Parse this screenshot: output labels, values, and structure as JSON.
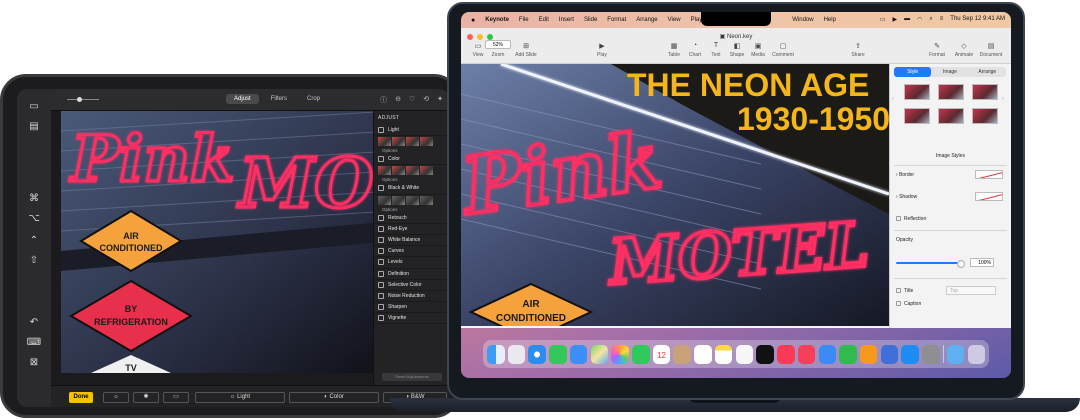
{
  "ipad": {
    "sidecar_icons": [
      "sidebar-icon",
      "menu-icon",
      "command-key-icon",
      "option-key-icon",
      "control-key-icon",
      "shift-key-icon",
      "undo-icon",
      "keyboard-icon",
      "disconnect-icon"
    ],
    "photos": {
      "tabs": [
        {
          "label": "Adjust",
          "active": true
        },
        {
          "label": "Filters",
          "active": false
        },
        {
          "label": "Crop",
          "active": false
        }
      ],
      "panel_title": "ADJUST",
      "adjustments": [
        {
          "label": "Light",
          "expanded": true,
          "options": "Options"
        },
        {
          "label": "Color",
          "expanded": true,
          "options": "Options"
        },
        {
          "label": "Black & White",
          "expanded": true,
          "options": "Options"
        },
        {
          "label": "Retouch"
        },
        {
          "label": "Red-Eye"
        },
        {
          "label": "White Balance"
        },
        {
          "label": "Curves"
        },
        {
          "label": "Levels"
        },
        {
          "label": "Definition"
        },
        {
          "label": "Selective Color"
        },
        {
          "label": "Noise Reduction"
        },
        {
          "label": "Sharpen"
        },
        {
          "label": "Vignette"
        }
      ],
      "reset_label": "Reset Adjustments",
      "done_label": "Done",
      "modes": [
        "Light",
        "Color",
        "B&W"
      ],
      "image_signs": {
        "air": "AIR",
        "conditioned": "CONDITIONED",
        "by": "BY",
        "refrigeration": "REFRIGERATION",
        "pink": "Pink",
        "motel": "MO",
        "tv": "TV"
      }
    }
  },
  "mac": {
    "menubar": {
      "app": "Keynote",
      "items": [
        "File",
        "Edit",
        "Insert",
        "Slide",
        "Format",
        "Arrange",
        "View",
        "Play",
        "Window",
        "Help"
      ],
      "datetime": "Thu Sep 12  9:41 AM"
    },
    "keynote": {
      "document_title": "Neon.key",
      "zoom": "52%",
      "toolbar": [
        {
          "label": "View",
          "icon": "sidebar-icon"
        },
        {
          "label": "Zoom",
          "icon": "zoom-icon"
        },
        {
          "label": "Add Slide",
          "icon": "add-slide-icon"
        },
        {
          "label": "Play",
          "icon": "play-icon"
        },
        {
          "label": "Table",
          "icon": "table-icon"
        },
        {
          "label": "Chart",
          "icon": "chart-icon"
        },
        {
          "label": "Text",
          "icon": "text-icon"
        },
        {
          "label": "Shape",
          "icon": "shape-icon"
        },
        {
          "label": "Media",
          "icon": "media-icon"
        },
        {
          "label": "Comment",
          "icon": "comment-icon"
        },
        {
          "label": "Share",
          "icon": "share-icon"
        },
        {
          "label": "Format",
          "icon": "format-brush-icon"
        },
        {
          "label": "Animate",
          "icon": "animate-icon"
        },
        {
          "label": "Document",
          "icon": "document-icon"
        }
      ],
      "slide": {
        "title_line1": "THE NEON AGE",
        "title_line2": "1930-1950",
        "sign_pink": "Pink",
        "sign_motel": "MOTEL",
        "sign_air": "AIR",
        "sign_conditioned": "CONDITIONED"
      },
      "inspector": {
        "tabs": [
          "Style",
          "Image",
          "Arrange"
        ],
        "active_tab": "Style",
        "section_title": "Image Styles",
        "border": "Border",
        "shadow": "Shadow",
        "reflection": "Reflection",
        "opacity_label": "Opacity",
        "opacity_value": "100%",
        "title_label": "Title",
        "title_position": "Top",
        "caption_label": "Caption"
      }
    },
    "dock_icons": [
      "finder-icon",
      "launchpad-icon",
      "safari-icon",
      "messages-icon",
      "mail-icon",
      "maps-icon",
      "photos-icon",
      "facetime-icon",
      "calendar-icon",
      "contacts-icon",
      "reminders-icon",
      "notes-icon",
      "freeform-icon",
      "tv-icon",
      "music-icon",
      "news-icon",
      "keynote-icon",
      "numbers-icon",
      "pages-icon",
      "iphone-mirroring-icon",
      "app-store-icon",
      "settings-icon",
      "downloads-icon",
      "trash-icon"
    ],
    "calendar_day": "12",
    "colors": {
      "accent": "#1f7cf5",
      "neon_pink": "#ff2e63",
      "title_yellow": "#f4b61a",
      "done_yellow": "#f5c400"
    }
  }
}
